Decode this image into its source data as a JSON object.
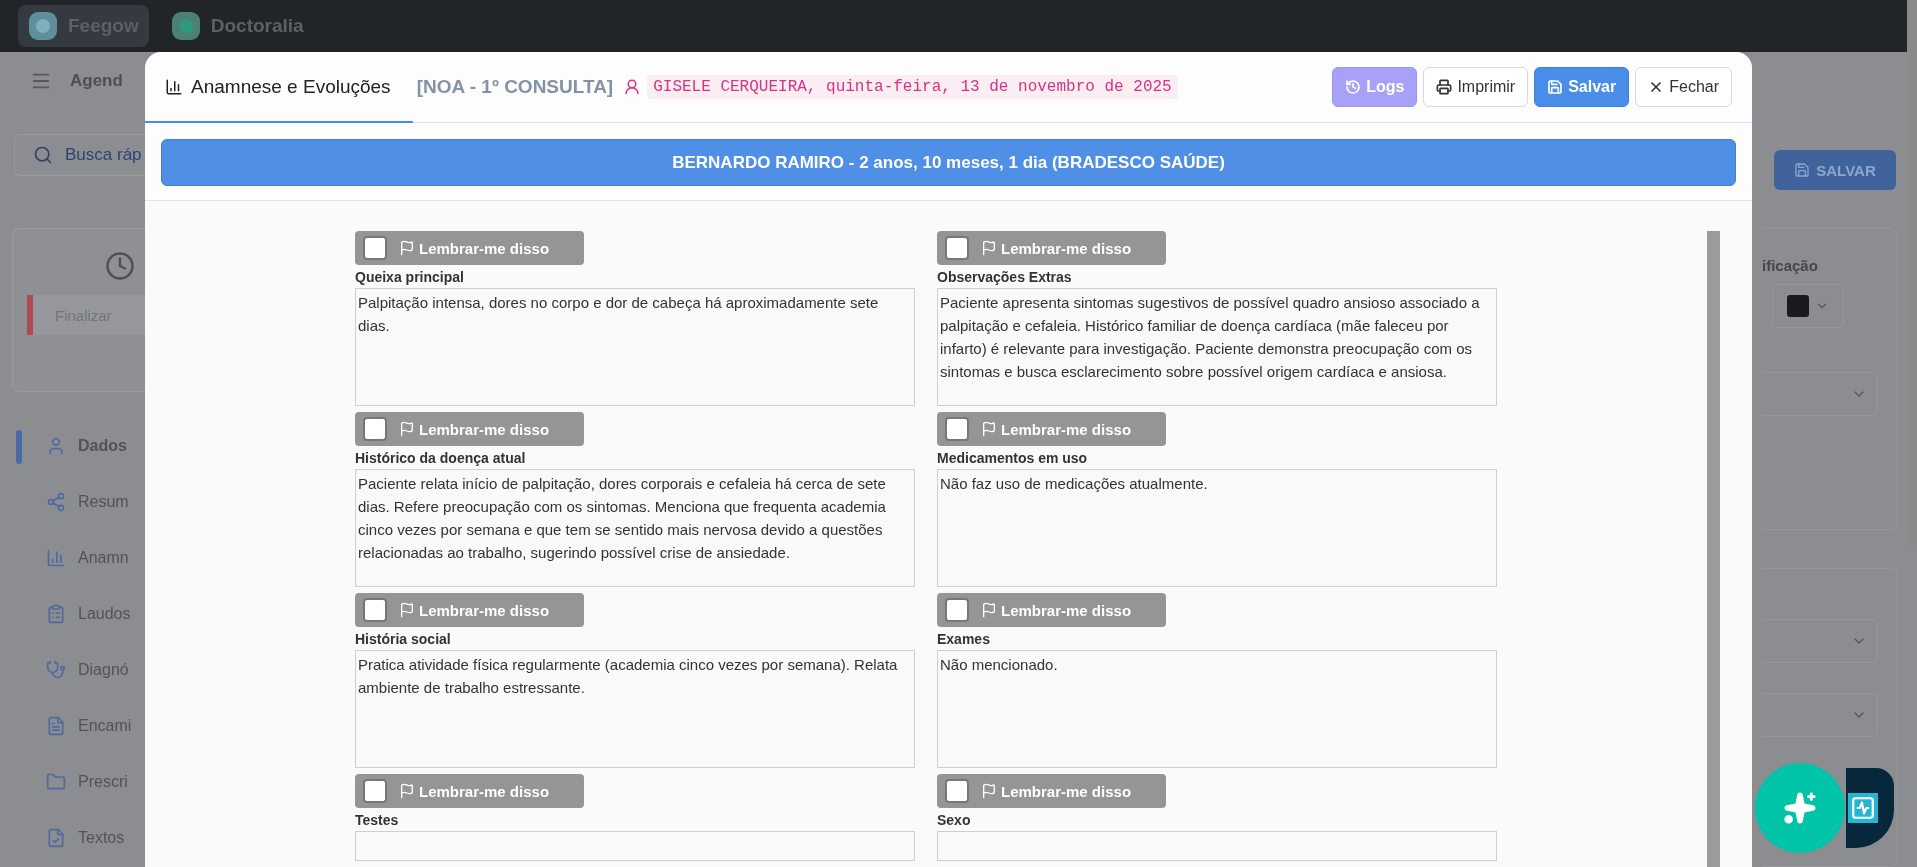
{
  "top_bar": {
    "tabs": [
      {
        "label": "Feegow",
        "selected": true
      },
      {
        "label": "Doctoralia",
        "selected": false
      }
    ]
  },
  "background": {
    "header_label": "Agend",
    "search": {
      "placeholder": "Busca ráp"
    },
    "finish_button": "Finalizar",
    "nav_items": [
      {
        "label": "Dados",
        "selected": true
      },
      {
        "label": "Resum",
        "selected": false
      },
      {
        "label": "Anamn",
        "selected": false
      },
      {
        "label": "Laudos",
        "selected": false
      },
      {
        "label": "Diagnó",
        "selected": false
      },
      {
        "label": "Encami",
        "selected": false
      },
      {
        "label": "Prescri",
        "selected": false
      },
      {
        "label": "Textos",
        "selected": false
      }
    ],
    "save_button": "SALVAR",
    "field_label": "ificação"
  },
  "modal": {
    "tabs": [
      {
        "label": "Anamnese e Evoluções",
        "selected": true
      }
    ],
    "appointment_type": "[NOA - 1º CONSULTA]",
    "patient_info": "GISELE CERQUEIRA, quinta-feira, 13 de novembro de 2025",
    "buttons": [
      {
        "kind": "logs",
        "label": "Logs"
      },
      {
        "kind": "print",
        "label": "Imprimir"
      },
      {
        "kind": "save",
        "label": "Salvar"
      },
      {
        "kind": "close",
        "label": "Fechar"
      }
    ],
    "banner": "BERNARDO RAMIRO - 2 anos, 10 meses, 1 dia (BRADESCO SAÚDE)",
    "fields": [
      {
        "label": "Queixa principal",
        "value": "Palpitação intensa, dores no corpo e dor de cabeça há aproximadamente sete dias.",
        "reminder": {
          "label": "Lembrar-me disso",
          "checked": false
        }
      },
      {
        "label": "Observações Extras",
        "value": "Paciente apresenta sintomas sugestivos de possível quadro ansioso associado a palpitação e cefaleia. Histórico familiar de doença cardíaca (mãe faleceu por infarto) é relevante para investigação. Paciente demonstra preocupação com os sintomas e busca esclarecimento sobre possível origem cardíaca e ansiosa.",
        "reminder": {
          "label": "Lembrar-me disso",
          "checked": false
        }
      },
      {
        "label": "Histórico da doença atual",
        "value": "Paciente relata início de palpitação, dores corporais e cefaleia há cerca de sete dias. Refere preocupação com os sintomas. Menciona que frequenta academia cinco vezes por semana e que tem se sentido mais nervosa devido a questões relacionadas ao trabalho, sugerindo possível crise de ansiedade.",
        "reminder": {
          "label": "Lembrar-me disso",
          "checked": false
        }
      },
      {
        "label": "Medicamentos em uso",
        "value": "Não faz uso de medicações atualmente.",
        "reminder": {
          "label": "Lembrar-me disso",
          "checked": false
        }
      },
      {
        "label": "História social",
        "value": "Pratica atividade física regularmente (academia cinco vezes por semana). Relata ambiente de trabalho estressante.",
        "reminder": {
          "label": "Lembrar-me disso",
          "checked": false
        }
      },
      {
        "label": "Exames",
        "value": "Não mencionado.",
        "reminder": {
          "label": "Lembrar-me disso",
          "checked": false
        }
      },
      {
        "label": "Testes",
        "reminder": {
          "label": "Lembrar-me disso",
          "checked": false
        }
      },
      {
        "label": "Sexo",
        "reminder": {
          "label": "Lembrar-me disso",
          "checked": false
        }
      }
    ]
  }
}
